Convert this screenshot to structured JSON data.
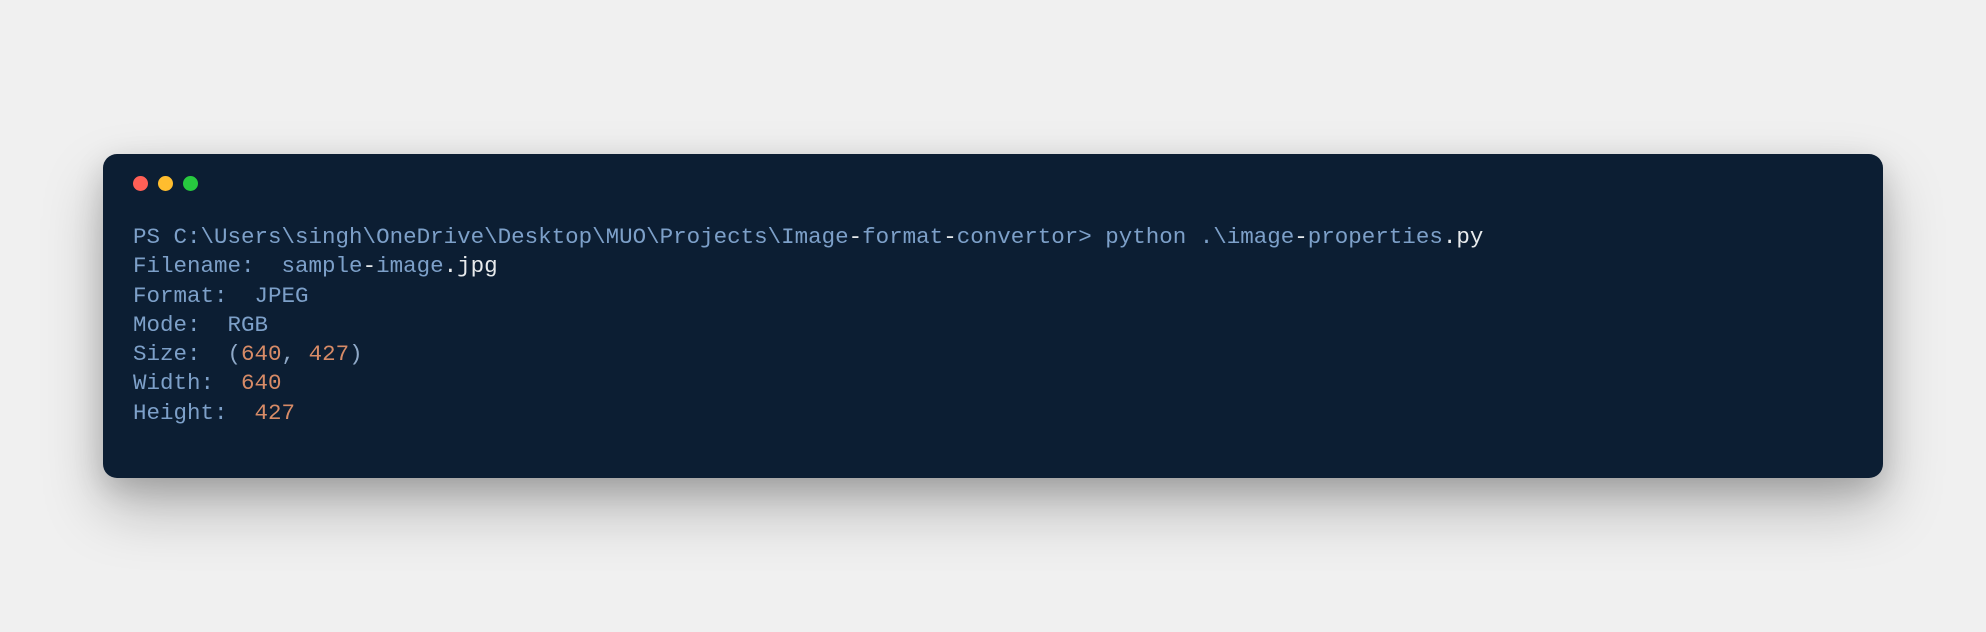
{
  "prompt": {
    "ps": "PS",
    "path_pre": "C:\\Users\\singh\\OneDrive\\Desktop\\MUO\\Projects\\Image",
    "dash1": "-",
    "path_mid": "format",
    "dash2": "-",
    "path_end": "convertor>",
    "cmd": " python ",
    "arg_pre": ".\\image",
    "dash3": "-",
    "arg_post": "properties",
    "dot": ".",
    "ext": "py"
  },
  "output": {
    "filename_label": "Filename:",
    "filename_pre": "  sample",
    "filename_dash": "-",
    "filename_mid": "image",
    "filename_dot": ".",
    "filename_ext": "jpg",
    "format_label": "Format:",
    "format_value": "  JPEG",
    "mode_label": "Mode:",
    "mode_value": "  RGB",
    "size_label": "Size:",
    "size_open": "  (",
    "size_w": "640",
    "size_comma": ", ",
    "size_h": "427",
    "size_close": ")",
    "width_label": "Width:",
    "width_space": "  ",
    "width_value": "640",
    "height_label": "Height:",
    "height_space": "  ",
    "height_value": "427"
  }
}
